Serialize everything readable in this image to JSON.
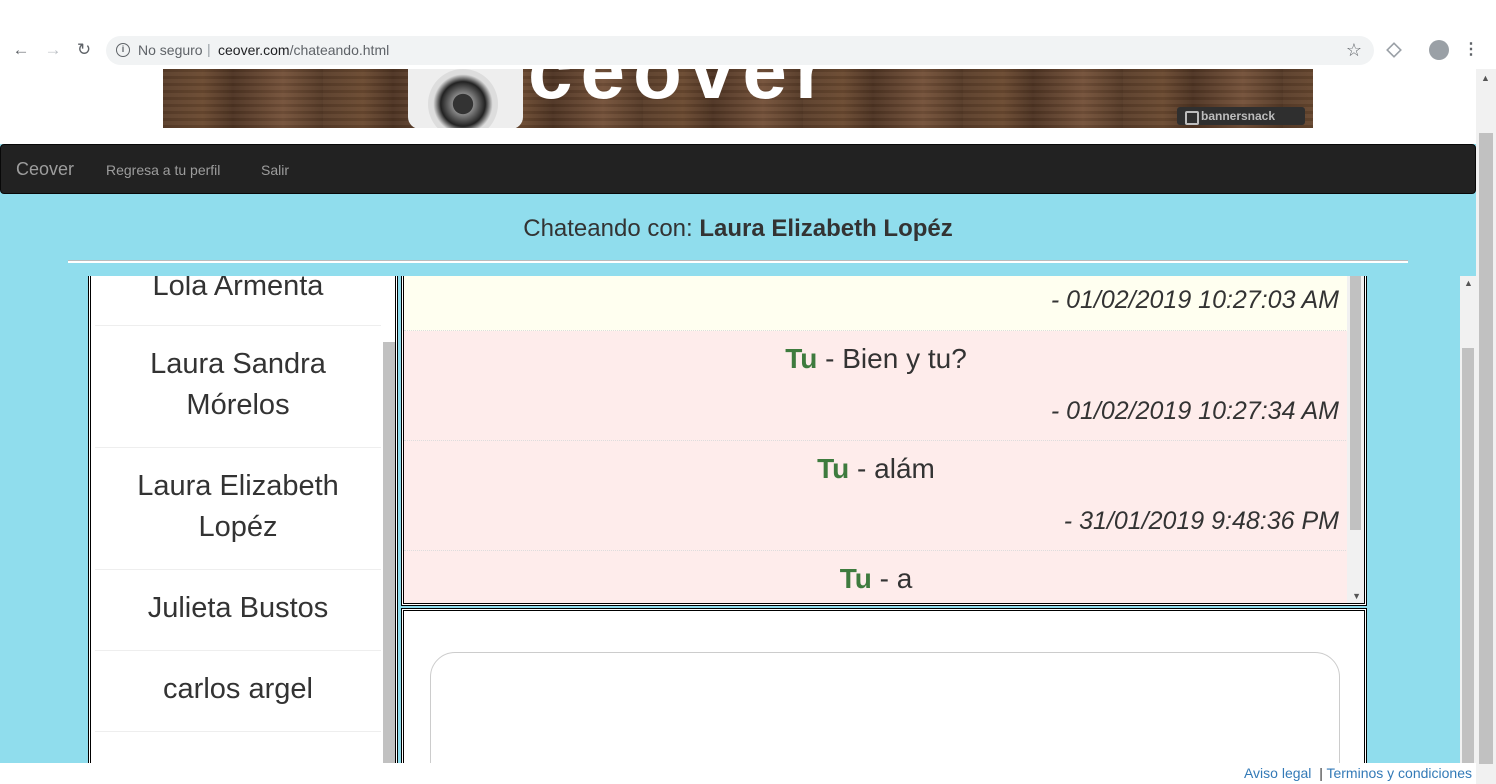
{
  "browser": {
    "back_icon": "←",
    "forward_icon": "→",
    "reload_icon": "↻",
    "info_icon": "i",
    "security_label": "No seguro",
    "separator": "|",
    "url_host": "ceover.com",
    "url_path": "/chateando.html",
    "star_icon": "☆",
    "menu_icon": "⋮"
  },
  "banner": {
    "title": "ceover",
    "badge": "bannersnack"
  },
  "navbar": {
    "brand": "Ceover",
    "links": [
      "Regresa a tu perfil",
      "Salir"
    ]
  },
  "chat": {
    "title_prefix": "Chateando con:",
    "contact_name": "Laura Elizabeth Lopéz"
  },
  "contacts": [
    "Lola Armenta",
    "Laura Sandra Mórelos",
    "Laura Elizabeth Lopéz",
    "Julieta Bustos",
    "carlos argel"
  ],
  "messages": [
    {
      "sender": "",
      "text": "",
      "time": "- 01/02/2019 10:27:03 AM"
    },
    {
      "sender": "Tu",
      "text": " - Bien y tu?",
      "time": "- 01/02/2019 10:27:34 AM"
    },
    {
      "sender": "Tu",
      "text": " - alám",
      "time": "- 31/01/2019 9:48:36 PM"
    },
    {
      "sender": "Tu",
      "text": " - a",
      "time": ""
    }
  ],
  "scroll_arrows": {
    "up": "▲",
    "down": "▼"
  },
  "footer": {
    "legal": "Aviso legal",
    "sep": "|",
    "terms": "Terminos y condiciones"
  },
  "colors": {
    "page_bg": "#90dded",
    "navbar_bg": "#222222",
    "my_message_bg": "#feeceb",
    "their_message_bg": "#fffff0",
    "sender_color": "#3e7b3e",
    "link_color": "#337ab7"
  }
}
